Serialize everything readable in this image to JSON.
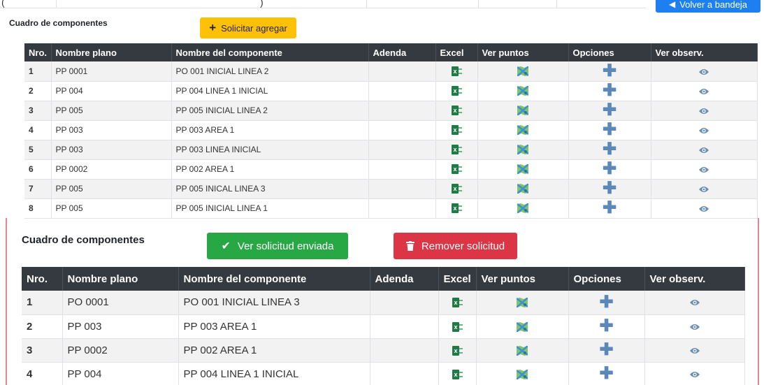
{
  "back_button": {
    "label": "Volver a bandeja"
  },
  "section1": {
    "title": "Cuadro de componentes",
    "request_add_label": "Solicitar agregar",
    "columns": [
      "Nro.",
      "Nombre plano",
      "Nombre del componente",
      "Adenda",
      "Excel",
      "Ver puntos",
      "Opciones",
      "Ver observ."
    ],
    "rows": [
      {
        "nro": "1",
        "plano": "PP 0001",
        "componente": "PO 001 INICIAL LINEA 2",
        "adenda": ""
      },
      {
        "nro": "2",
        "plano": "PP 004",
        "componente": "PP 004 LINEA 1 INICIAL",
        "adenda": ""
      },
      {
        "nro": "3",
        "plano": "PP 005",
        "componente": "PP 005 INICIAL LINEA 2",
        "adenda": ""
      },
      {
        "nro": "4",
        "plano": "PP 003",
        "componente": "PP 003 AREA 1",
        "adenda": ""
      },
      {
        "nro": "5",
        "plano": "PP 003",
        "componente": "PP 003 LINEA INICIAL",
        "adenda": ""
      },
      {
        "nro": "6",
        "plano": "PP 0002",
        "componente": "PP 002 AREA 1",
        "adenda": ""
      },
      {
        "nro": "7",
        "plano": "PP 005",
        "componente": "PP 005 INICAL LINEA 3",
        "adenda": ""
      },
      {
        "nro": "8",
        "plano": "PP 005",
        "componente": "PP 005 INICIAL LINEA 1",
        "adenda": ""
      }
    ]
  },
  "section2": {
    "title": "Cuadro de componentes",
    "view_request_label": "Ver solicitud enviada",
    "remove_request_label": "Remover solicitud",
    "columns": [
      "Nro.",
      "Nombre plano",
      "Nombre del componente",
      "Adenda",
      "Excel",
      "Ver puntos",
      "Opciones",
      "Ver observ."
    ],
    "rows": [
      {
        "nro": "1",
        "plano": "PO 0001",
        "componente": "PO 001 INICIAL LINEA 3",
        "adenda": ""
      },
      {
        "nro": "2",
        "plano": "PP 003",
        "componente": "PP 003 AREA 1",
        "adenda": ""
      },
      {
        "nro": "3",
        "plano": "PP 0002",
        "componente": "PP 002 AREA 1",
        "adenda": ""
      },
      {
        "nro": "4",
        "plano": "PP 004",
        "componente": "PP 004 LINEA 1 INICIAL",
        "adenda": ""
      }
    ]
  },
  "icons": {
    "excel": "excel-icon",
    "points": "map-icon",
    "options": "plus-icon",
    "observations": "eye-icon"
  },
  "colors": {
    "header_bg": "#343a40",
    "warning": "#ffc107",
    "success": "#28a745",
    "danger": "#dc3545",
    "primary": "#1e7ff0",
    "plus": "#5b87b9"
  }
}
